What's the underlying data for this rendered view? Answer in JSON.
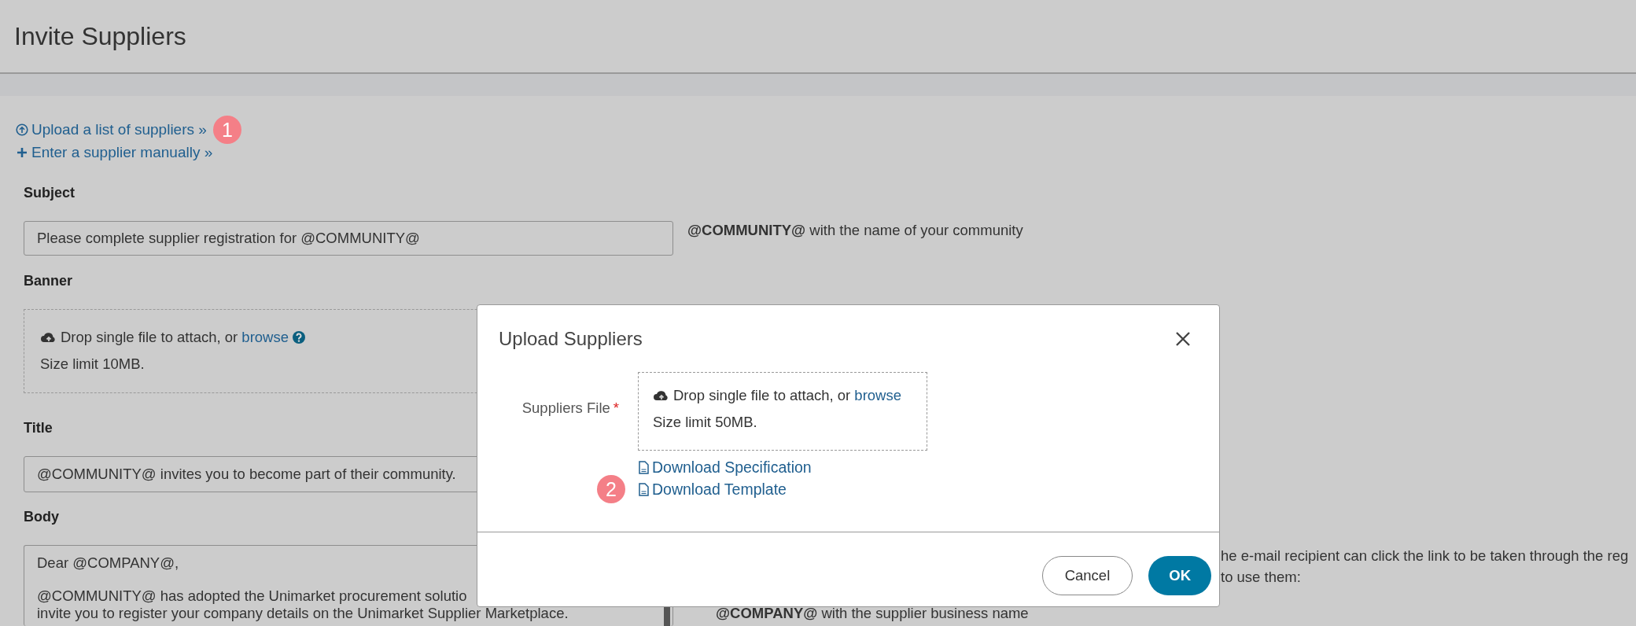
{
  "page": {
    "title": "Invite Suppliers"
  },
  "actions": [
    {
      "kind": "upload",
      "label": "Upload a list of suppliers »",
      "callout": "1"
    },
    {
      "kind": "add",
      "label": "Enter a supplier manually »"
    }
  ],
  "form": {
    "subject": {
      "label": "Subject",
      "value": "Please complete supplier registration for @COMMUNITY@",
      "hint": "**@COMMUNITY@** with the name of your community"
    },
    "banner": {
      "label": "Banner",
      "drop_text": "Drop single file to attach, or",
      "browse": "browse",
      "limit": "Size limit 10MB."
    },
    "title": {
      "label": "Title",
      "value": "@COMMUNITY@ invites you to become part of their community."
    },
    "body": {
      "label": "Body",
      "paragraphs": [
        [
          "Dear @COMPANY@,"
        ],
        [
          "@COMMUNITY@ has adopted the Unimarket procurement solutio",
          "invite you to register your company details on the Unimarket Supplier Marketplace."
        ]
      ]
    },
    "body_help": {
      "lines": [
        "he e-mail recipient can click the link to be taken through the reg",
        "to use them:"
      ],
      "note": "**@COMPANY@** with the supplier business name"
    }
  },
  "modal": {
    "title": "Upload Suppliers",
    "field_label": "Suppliers File",
    "required_mark": "*",
    "drop_text": "Drop single file to attach, or",
    "browse": "browse",
    "limit": "Size limit 50MB.",
    "downloads": [
      {
        "label": "Download Specification"
      },
      {
        "label": "Download Template",
        "callout": "2"
      }
    ],
    "buttons": [
      {
        "kind": "secondary",
        "label": "Cancel"
      },
      {
        "kind": "primary",
        "label": "OK"
      }
    ]
  }
}
